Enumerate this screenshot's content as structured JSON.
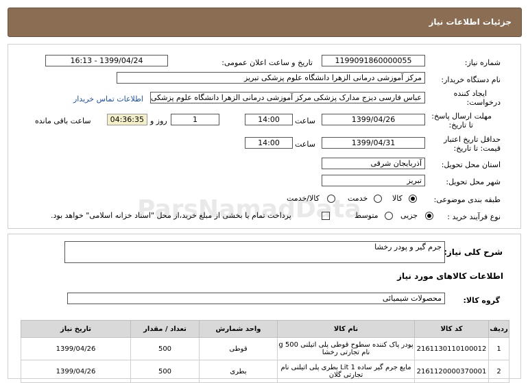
{
  "header": {
    "title": "جزئیات اطلاعات نیاز"
  },
  "form": {
    "need_number_label": "شماره نیاز:",
    "need_number": "1199091860000055",
    "announce_label": "تاریخ و ساعت اعلان عمومی:",
    "announce_value": "1399/04/24 - 16:13",
    "buyer_org_label": "نام دستگاه خریدار:",
    "buyer_org": "مرکز آموزشی درمانی الزهرا دانشگاه علوم پزشکی تبریز",
    "requester_label_1": "ایجاد کننده",
    "requester_label_2": "درخواست:",
    "requester": "عباس  فارسی دیزج  مدارک پزشکی  مرکز آموزشی درمانی الزهرا دانشگاه علوم پزشکی تبریز",
    "contact_link": "اطلاعات تماس خریدار",
    "deadline_label_1": "مهلت ارسال پاسخ:",
    "deadline_label_2": "تا تاریخ:",
    "deadline_date": "1399/04/26",
    "time_label": "ساعت",
    "deadline_time": "14:00",
    "days_value": "1",
    "days_label": "روز و",
    "remaining_time": "04:36:35",
    "remaining_label": "ساعت باقی مانده",
    "validity_label_1": "حداقل تاریخ اعتبار",
    "validity_label_2": "قیمت: تا تاریخ:",
    "validity_date": "1399/04/31",
    "validity_time_label": "ساعت",
    "validity_time": "14:00",
    "province_label": "استان محل تحویل:",
    "province": "آذربایجان شرقی",
    "city_label": "شهر محل تحویل:",
    "city": "تبریز",
    "category_label": "طبقه بندی موضوعی:",
    "category_options": [
      "کالا",
      "خدمت",
      "کالا/خدمت"
    ],
    "category_selected": "کالا",
    "process_label": "نوع فرآیند خرید :",
    "process_options": [
      "جزیی",
      "متوسط"
    ],
    "process_selected": "جزیی",
    "payment_note": "پرداخت تمام یا بخشی از مبلغ خرید،از محل \"اسناد خزانه اسلامی\" خواهد بود."
  },
  "summary": {
    "desc_label": "شرح کلی نیاز:",
    "desc_value": "جرم گیر و پودر رخشا",
    "goods_info_title": "اطلاعات کالاهای مورد نیاز",
    "group_label": "گروه کالا:",
    "group_value": "محصولات شیمیائی"
  },
  "watermark": {
    "line1": "ParsNamadData",
    "line2": "پایگاه اطلاع رسانی مناقصه و مزایده",
    "line3": "۰۲۱-۸۸۳۴۹۶۷۰-۵"
  },
  "table": {
    "headers": [
      "ردیف",
      "کد کالا",
      "نام کالا",
      "واحد شمارش",
      "تعداد / مقدار",
      "تاریخ نیاز"
    ],
    "rows": [
      [
        "1",
        "2161130110100012",
        "پودر پاک کننده سطوح قوطی پلی اتیلنی 500 g نام تجارتی رخشا",
        "قوطی",
        "500",
        "1399/04/26"
      ],
      [
        "2",
        "2161120000370001",
        "مایع جرم گیر ساده 1 Lit بطری پلی اتیلنی نام تجارتی گلان",
        "بطری",
        "500",
        "1399/04/26"
      ]
    ]
  }
}
